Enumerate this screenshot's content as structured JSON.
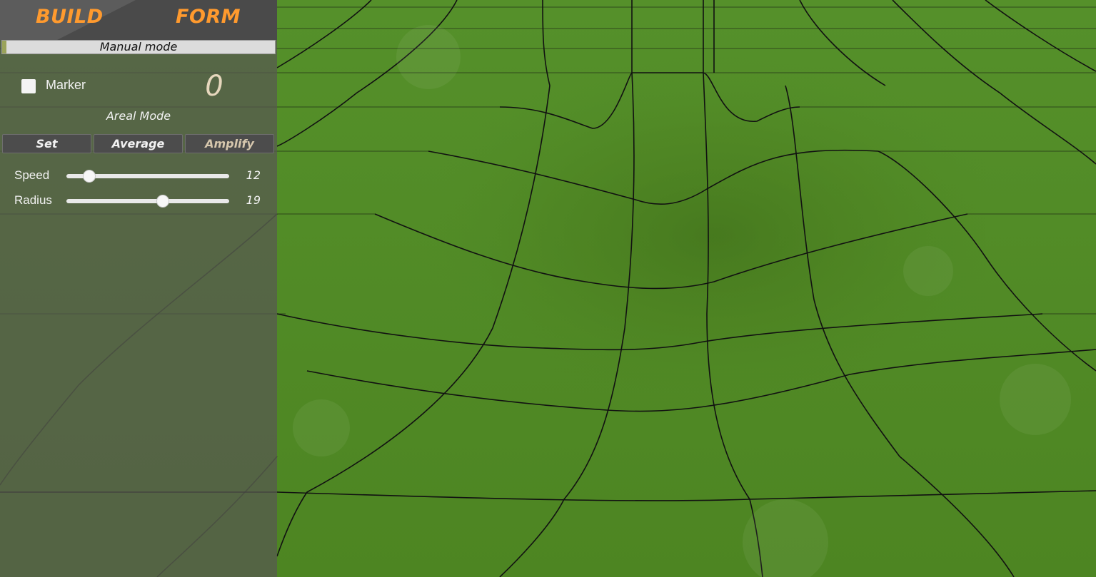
{
  "header": {
    "tabs": [
      {
        "label": "BUILD"
      },
      {
        "label": "FORM"
      }
    ],
    "accent_color": "#ff9a2e"
  },
  "mode": {
    "label": "Manual mode"
  },
  "marker": {
    "label": "Marker",
    "checked": false,
    "count": "0"
  },
  "areal": {
    "title": "Areal Mode",
    "buttons": [
      {
        "label": "Set"
      },
      {
        "label": "Average"
      },
      {
        "label": "Amplify"
      }
    ]
  },
  "sliders": [
    {
      "label": "Speed",
      "value": "12",
      "fraction": 0.14
    },
    {
      "label": "Radius",
      "value": "19",
      "fraction": 0.59
    }
  ],
  "scene": {
    "ground": "grass terrain with sculpted depression",
    "grid_color": "#111111"
  }
}
